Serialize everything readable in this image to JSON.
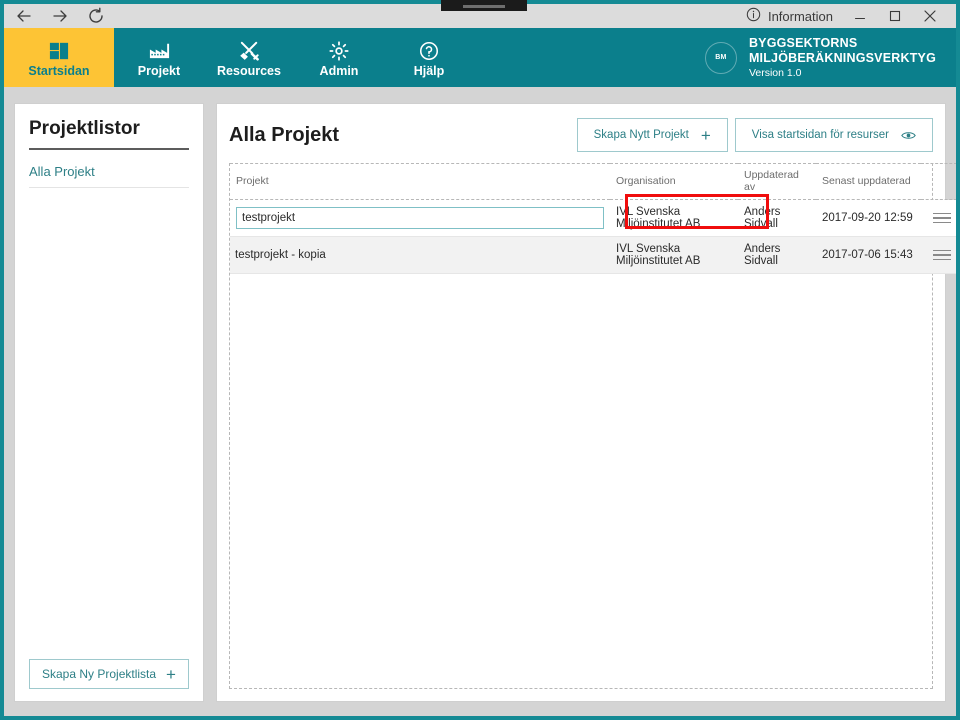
{
  "window": {
    "back_icon": "back-arrow-icon",
    "forward_icon": "forward-arrow-icon",
    "reload_icon": "reload-icon",
    "information_label": "Information",
    "information_icon": "info-circle-icon",
    "minimize_label": "—",
    "maximize_label": "□",
    "close_label": "✕"
  },
  "nav": {
    "items": [
      {
        "label": "Startsidan",
        "icon": "dashboard-icon",
        "active": true
      },
      {
        "label": "Projekt",
        "icon": "factory-icon",
        "active": false
      },
      {
        "label": "Resources",
        "icon": "tools-icon",
        "active": false
      },
      {
        "label": "Admin",
        "icon": "gear-icon",
        "active": false
      },
      {
        "label": "Hjälp",
        "icon": "question-circle-icon",
        "active": false
      }
    ]
  },
  "brand": {
    "logo_text": "BM",
    "line1": "BYGGSEKTORNS",
    "line2": "MILJÖBERÄKNINGSVERKTYG",
    "version": "Version 1.0"
  },
  "sidebar": {
    "title": "Projektlistor",
    "items": [
      {
        "label": "Alla Projekt"
      }
    ],
    "create_list_label": "Skapa Ny Projektlista",
    "create_list_icon": "plus-icon"
  },
  "main": {
    "title": "Alla Projekt",
    "create_project_label": "Skapa Nytt Projekt",
    "create_project_icon": "plus-icon",
    "show_resources_label": "Visa startsidan för resurser",
    "show_resources_icon": "eye-icon",
    "table": {
      "columns": [
        "Projekt",
        "Organisation",
        "Uppdaterad av",
        "Senast uppdaterad",
        ""
      ],
      "rows": [
        {
          "project": "testprojekt",
          "organisation": "IVL Svenska Miljöinstitutet AB",
          "updated_by": "Anders Sidvall",
          "last_updated": "2017-09-20 12:59",
          "editing": true,
          "menu_icon": "hamburger-menu-icon"
        },
        {
          "project": "testprojekt - kopia",
          "organisation": "IVL Svenska Miljöinstitutet AB",
          "updated_by": "Anders Sidvall",
          "last_updated": "2017-07-06 15:43",
          "editing": false,
          "menu_icon": "hamburger-menu-icon"
        }
      ]
    }
  },
  "colors": {
    "teal": "#0b7f8c",
    "yellow": "#fdc435",
    "link": "#2d7f86",
    "highlight": "#f00d0d",
    "chrome": "#dcdcdc",
    "page_bg": "#d4d4d4"
  }
}
